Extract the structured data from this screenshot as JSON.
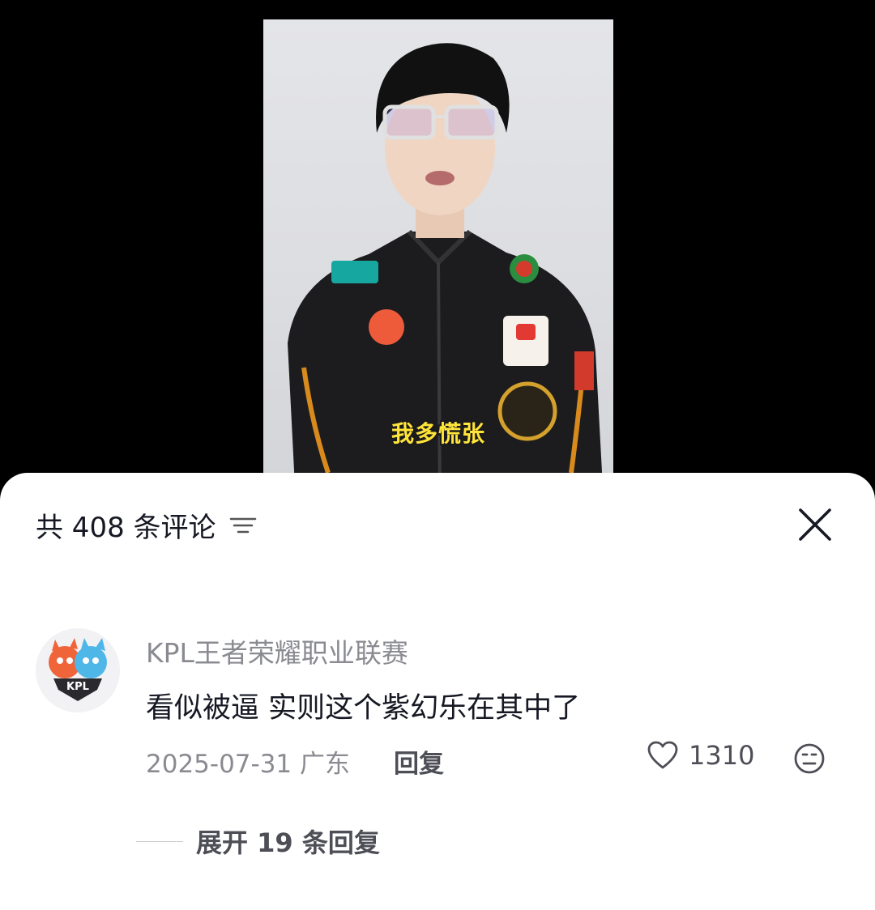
{
  "video": {
    "subtitle": "我多慌张"
  },
  "comments_panel": {
    "title": "共 408 条评论",
    "filter_icon": "filter-icon",
    "close_icon": "close-icon"
  },
  "comment": {
    "avatar_icon": "kpl-mascot-avatar",
    "username": "KPL王者荣耀职业联赛",
    "text": "看似被逼 实则这个紫幻乐在其中了",
    "date_location": "2025-07-31 广东",
    "reply_label": "回复",
    "like_icon": "heart-icon",
    "like_count": "1310",
    "dislike_icon": "meh-face-icon"
  },
  "expand": {
    "label": "展开 19 条回复"
  }
}
